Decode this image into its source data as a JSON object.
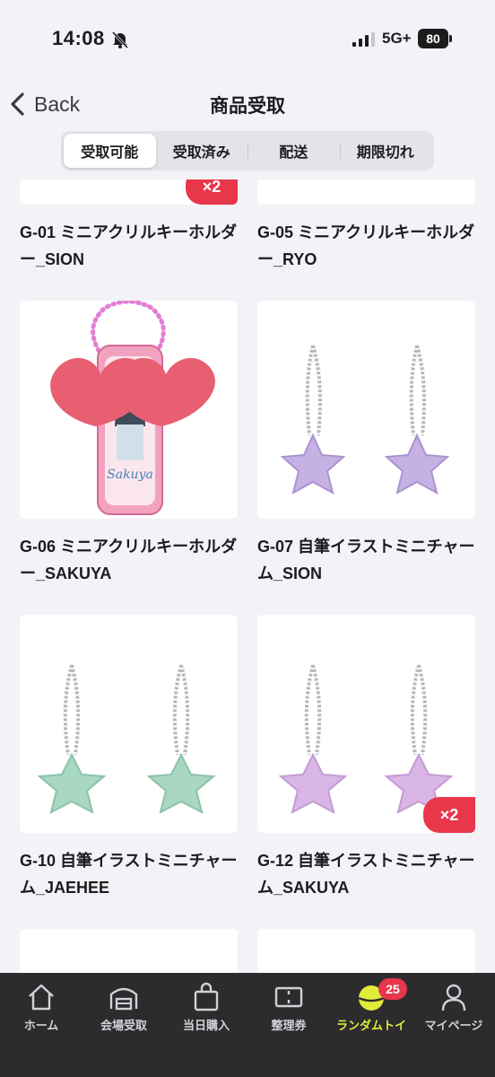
{
  "status_bar": {
    "time": "14:08",
    "network": "5G+",
    "battery": "80"
  },
  "nav": {
    "back_label": "Back",
    "title": "商品受取"
  },
  "segments": [
    {
      "label": "受取可能",
      "active": true
    },
    {
      "label": "受取済み",
      "active": false
    },
    {
      "label": "配送",
      "active": false
    },
    {
      "label": "期限切れ",
      "active": false
    }
  ],
  "items": [
    {
      "title": "G-01 ミニアクリルキーホルダー_SION",
      "qty": "×2"
    },
    {
      "title": "G-05 ミニアクリルキーホルダー_RYO",
      "qty": ""
    },
    {
      "title": "G-06 ミニアクリルキーホルダー_SAKUYA",
      "qty": ""
    },
    {
      "title": "G-07 自筆イラストミニチャーム_SION",
      "qty": ""
    },
    {
      "title": "G-10 自筆イラストミニチャーム_JAEHEE",
      "qty": ""
    },
    {
      "title": "G-12 自筆イラストミニチャーム_SAKUYA",
      "qty": "×2"
    }
  ],
  "tabs": [
    {
      "label": "ホーム",
      "icon": "home-icon"
    },
    {
      "label": "会場受取",
      "icon": "venue-icon"
    },
    {
      "label": "当日購入",
      "icon": "shopping-bag-icon"
    },
    {
      "label": "整理券",
      "icon": "ticket-icon"
    },
    {
      "label": "ランダムトイ",
      "icon": "random-toy-icon",
      "badge": "25",
      "active": true
    },
    {
      "label": "マイページ",
      "icon": "person-icon"
    }
  ],
  "colors": {
    "accent": "#e1ec3a",
    "badge": "#e8364a",
    "tab_bar": "#2c2c2e"
  }
}
